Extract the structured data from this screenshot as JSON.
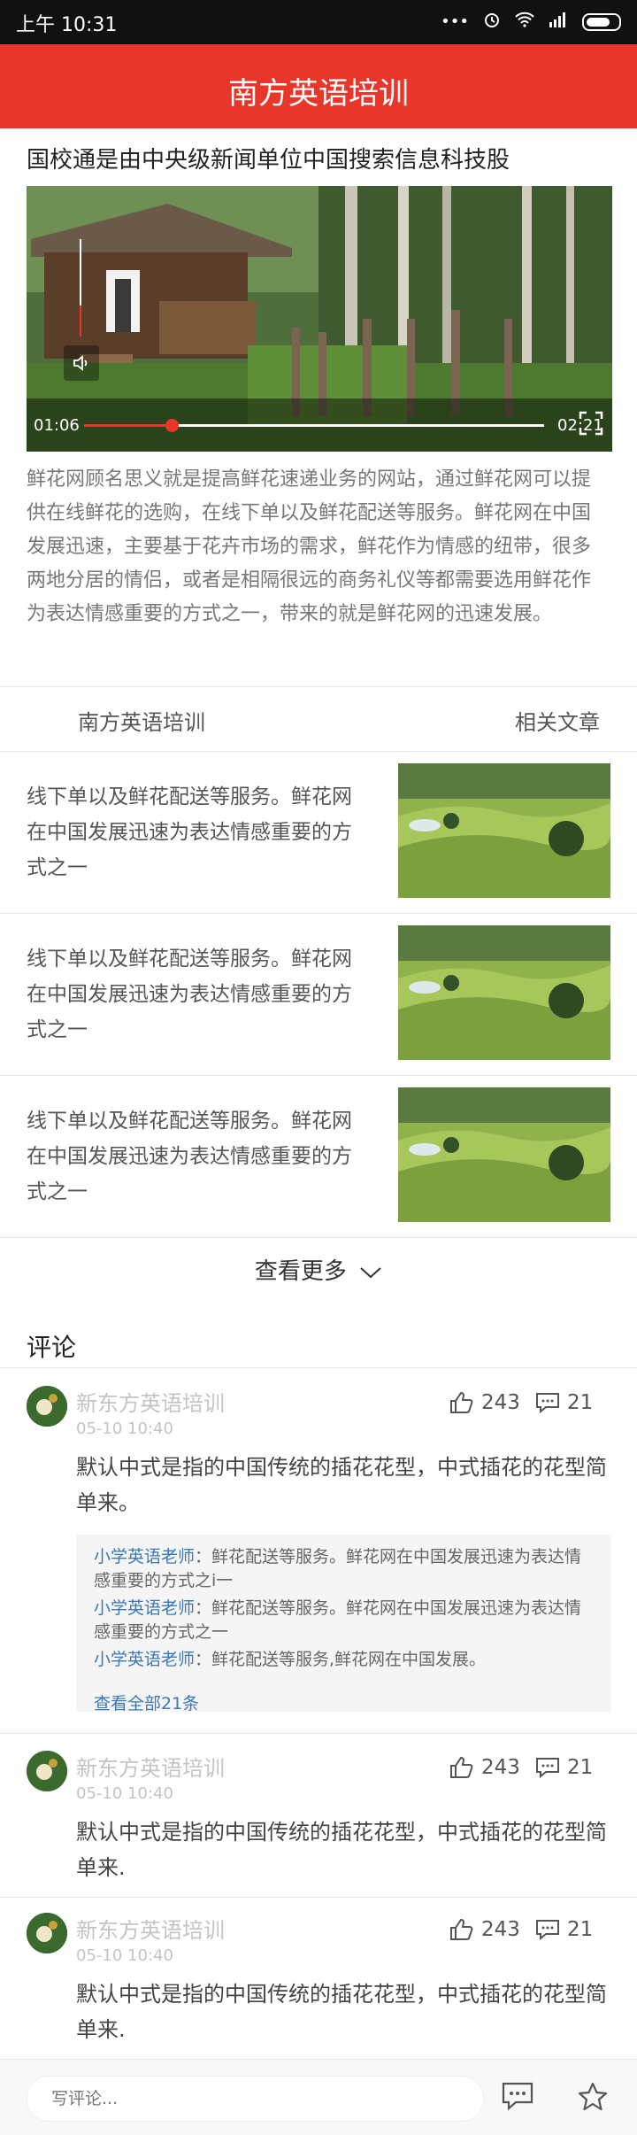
{
  "status_bar": {
    "time": "上午 10:31",
    "dots": "•••"
  },
  "app_bar": {
    "title": "南方英语培训",
    "color": "#e8372a"
  },
  "headline": "国校通是由中央级新闻单位中国搜索信息科技股",
  "video": {
    "current_time": "01:06",
    "duration": "02:21",
    "progress": 0.19,
    "volume_level": 0.32
  },
  "description": "鲜花网顾名思义就是提高鲜花速递业务的网站，通过鲜花网可以提供在线鲜花的选购，在线下单以及鲜花配送等服务。鲜花网在中国发展迅速，主要基于花卉市场的需求，鲜花作为情感的纽带，很多两地分居的情侣，或者是相隔很远的商务礼仪等都需要选用鲜花作为表达情感重要的方式之一，带来的就是鲜花网的迅速发展。",
  "tabs": {
    "left": "南方英语培训",
    "right": "相关文章"
  },
  "articles": [
    {
      "text": "线下单以及鲜花配送等服务。鲜花网在中国发展迅速为表达情感重要的方式之一"
    },
    {
      "text": "线下单以及鲜花配送等服务。鲜花网在中国发展迅速为表达情感重要的方式之一"
    },
    {
      "text": "线下单以及鲜花配送等服务。鲜花网在中国发展迅速为表达情感重要的方式之一"
    }
  ],
  "more_label": "查看更多",
  "comments_title": "评论",
  "comments": [
    {
      "name": "新东方英语培训",
      "date": "05-10  10:40",
      "likes": "243",
      "replies": "21",
      "text": "默认中式是指的中国传统的插花花型，中式插花的花型简单来。"
    },
    {
      "name": "新东方英语培训",
      "date": "05-10  10:40",
      "likes": "243",
      "replies": "21",
      "text": "默认中式是指的中国传统的插花花型，中式插花的花型简单来."
    },
    {
      "name": "新东方英语培训",
      "date": "05-10  10:40",
      "likes": "243",
      "replies": "21",
      "text": "默认中式是指的中国传统的插花花型，中式插花的花型简单来."
    }
  ],
  "reply_block": {
    "items": [
      {
        "who": "小学英语老师",
        "text": "：鲜花配送等服务。鲜花网在中国发展迅速为表达情感重要的方式之i一"
      },
      {
        "who": "小学英语老师",
        "text": "：鲜花配送等服务。鲜花网在中国发展迅速为表达情感重要的方式之一"
      },
      {
        "who": "小学英语老师",
        "text": "：鲜花配送等服务,鲜花网在中国发展。"
      }
    ],
    "view_all": "查看全部21条"
  },
  "bottom_bar": {
    "placeholder": "写评论..."
  }
}
